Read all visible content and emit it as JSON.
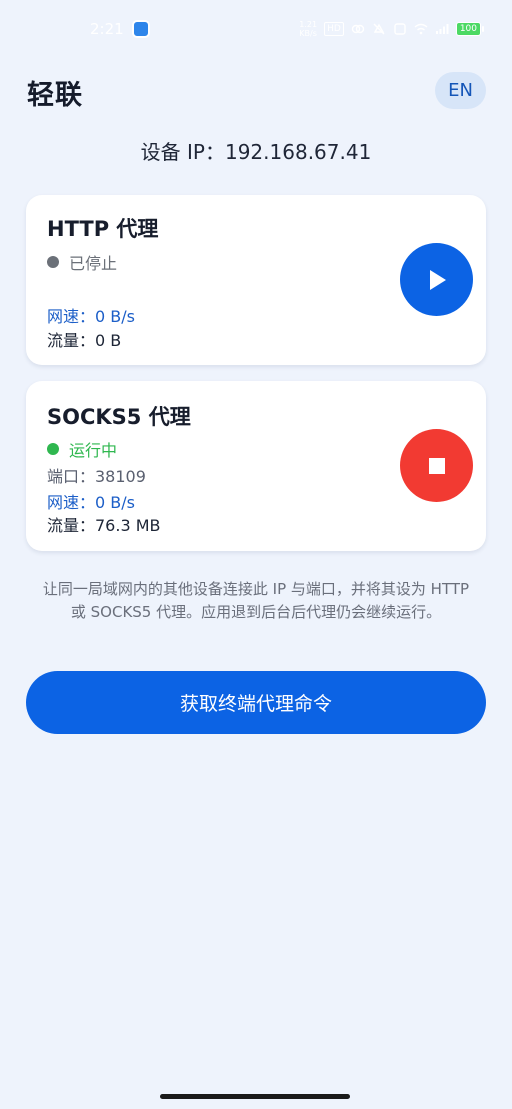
{
  "status_bar": {
    "time": "2:21",
    "network_speed": "1.21\nKB/s",
    "hd_badge": "HD",
    "battery": "100"
  },
  "header": {
    "title": "轻联",
    "lang_button": "EN"
  },
  "device_ip": "设备 IP：192.168.67.41",
  "http_card": {
    "title": "HTTP 代理",
    "status": "已停止",
    "status_color": "#6b7078",
    "speed": "网速：0 B/s",
    "traffic": "流量：0 B",
    "action_icon": "play-icon"
  },
  "socks_card": {
    "title": "SOCKS5 代理",
    "status": "运行中",
    "status_color": "#2fb74f",
    "port": "端口：38109",
    "speed": "网速：0 B/s",
    "traffic": "流量：76.3 MB",
    "action_icon": "stop-icon"
  },
  "hint": "让同一局域网内的其他设备连接此 IP 与端口，并将其设为 HTTP 或 SOCKS5 代理。应用退到后台后代理仍会继续运行。",
  "primary_button": "获取终端代理命令",
  "colors": {
    "accent": "#0c63e4",
    "stop": "#f23a32",
    "running": "#2fb74f",
    "background": "#eef3fc"
  }
}
